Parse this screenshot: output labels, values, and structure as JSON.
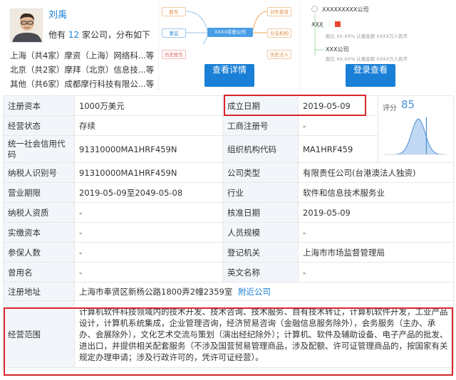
{
  "person": {
    "name": "刘禹",
    "count_prefix": "他有",
    "count": "12",
    "count_suffix": "家公司，分布如下",
    "regions": [
      {
        "label": "上海（共4家）摩资（上海）网络科...等"
      },
      {
        "label": "北京（共2家）摩拜（北京）信息技...等"
      },
      {
        "label": "其他（共6家）成都摩行科技有限公...等"
      }
    ]
  },
  "graph": {
    "center": "XXXX有限公司",
    "left_nodes": [
      "股东",
      "董监",
      "历史股东"
    ],
    "right_nodes": [
      "对外投资",
      "分支机构",
      "历史法人"
    ],
    "button": "查看详情"
  },
  "relation": {
    "company": "XXXXXXXXX公司",
    "person_name": "XXX",
    "person_detail": "股比 XX.XX% 认缴金额 XXXX万人民币",
    "sub_company": "XXX公司",
    "sub_detail": "股比 XX.XX% 认缴金额 XXXX万人民币",
    "button": "登录查看"
  },
  "table": {
    "rows": [
      {
        "l1": "注册资本",
        "v1": "1000万美元",
        "l2": "成立日期",
        "v2": "2019-05-09"
      },
      {
        "l1": "经营状态",
        "v1": "存续",
        "l2": "工商注册号",
        "v2": "-"
      },
      {
        "l1": "统一社会信用代码",
        "v1": "91310000MA1HRF459N",
        "l2": "组织机构代码",
        "v2": "MA1HRF459"
      },
      {
        "l1": "纳税人识别号",
        "v1": "91310000MA1HRF459N",
        "l2": "公司类型",
        "v2": "有限责任公司(台港澳法人独资)"
      },
      {
        "l1": "营业期限",
        "v1": "2019-05-09至2049-05-08",
        "l2": "行业",
        "v2": "软件和信息技术服务业"
      },
      {
        "l1": "纳税人资质",
        "v1": "-",
        "l2": "核准日期",
        "v2": "2019-05-09"
      },
      {
        "l1": "实缴资本",
        "v1": "-",
        "l2": "人员规模",
        "v2": "-"
      },
      {
        "l1": "参保人数",
        "v1": "-",
        "l2": "登记机关",
        "v2": "上海市市场监督管理局"
      },
      {
        "l1": "曾用名",
        "v1": "-",
        "l2": "英文名称",
        "v2": "-"
      }
    ],
    "address_label": "注册地址",
    "address": "上海市奉贤区新杨公路1800弄2幢2359室",
    "address_link": "附近公司",
    "scope_label": "经营范围",
    "scope": "计算机软件科技领域内的技术开发、技术咨询、技术服务、自有技术转让，计算机软件开发，工业产品设计，计算机系统集成，企业管理咨询，经济贸易咨询（金融信息服务除外），会务服务（主办、承办、会展除外），文化艺术交流与策划（演出经纪除外）；计算机、软件及辅助设备、电子产品的批发、进出口，并提供相关配套服务（不涉及国营贸易管理商品，涉及配额、许可证管理商品的，按国家有关规定办理申请；涉及行政许可的，凭许可证经营）。"
  },
  "score": {
    "label": "评分",
    "value": "85",
    "chart": {
      "type": "area",
      "value": 85,
      "color": "#4a90d9"
    }
  },
  "colors": {
    "accent": "#1a7fd6",
    "highlight": "#d9262c",
    "label_bg": "#f2f6fb"
  }
}
